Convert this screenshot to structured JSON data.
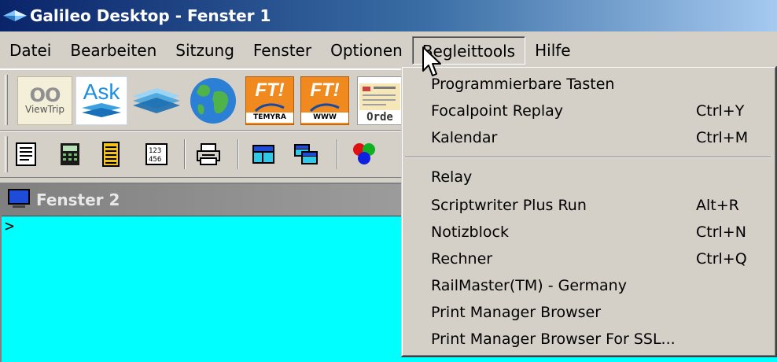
{
  "window": {
    "title": "Galileo Desktop - Fenster 1"
  },
  "menubar": {
    "items": [
      "Datei",
      "Bearbeiten",
      "Sitzung",
      "Fenster",
      "Optionen",
      "Begleittools",
      "Hilfe"
    ],
    "open_item": "Begleittools"
  },
  "toolbar1": {
    "viewtrip_label": "ViewTrip",
    "viewtrip_logo": "OO",
    "ask_label": "Ask",
    "ft_text": "FT!",
    "ft1_sub": "TEMYRA",
    "ft2_sub": "WWW",
    "order_label": "Orde"
  },
  "toolbar2": {
    "icons": [
      "document-icon",
      "calculator-icon",
      "notepad-icon",
      "keypad-icon",
      "printer-icon",
      "window-icon",
      "cascade-windows-icon",
      "color-balls-icon"
    ]
  },
  "child_window": {
    "title": "Fenster 2",
    "prompt": ">"
  },
  "dropdown": {
    "group1": [
      {
        "label": "Programmierbare Tasten",
        "shortcut": ""
      },
      {
        "label": "Focalpoint Replay",
        "shortcut": "Ctrl+Y"
      },
      {
        "label": "Kalendar",
        "shortcut": "Ctrl+M"
      }
    ],
    "group2": [
      {
        "label": "Relay",
        "shortcut": ""
      },
      {
        "label": "Scriptwriter Plus Run",
        "shortcut": "Alt+R"
      },
      {
        "label": "Notizblock",
        "shortcut": "Ctrl+N"
      },
      {
        "label": "Rechner",
        "shortcut": "Ctrl+Q"
      },
      {
        "label": "RailMaster(TM) - Germany",
        "shortcut": ""
      },
      {
        "label": "Print Manager Browser",
        "shortcut": ""
      },
      {
        "label": "Print Manager Browser For SSL...",
        "shortcut": ""
      }
    ]
  },
  "colors": {
    "titlebar_start": "#0a246a",
    "titlebar_end": "#a6caf0",
    "terminal_bg": "#00ffff",
    "chrome": "#d4d0c8"
  }
}
